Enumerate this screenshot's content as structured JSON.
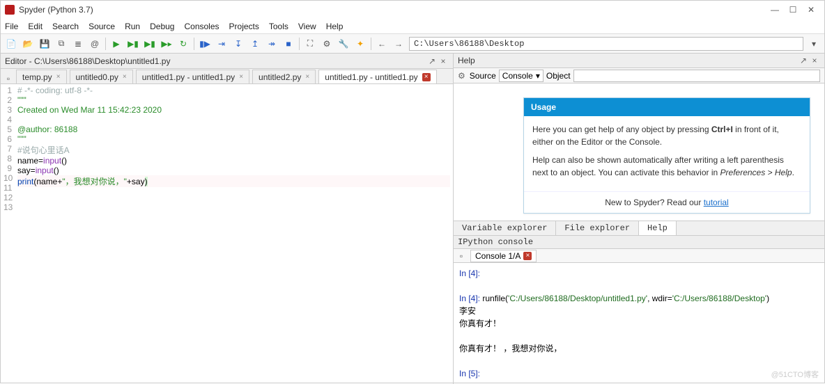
{
  "window": {
    "title": "Spyder (Python 3.7)"
  },
  "menus": [
    "File",
    "Edit",
    "Search",
    "Source",
    "Run",
    "Debug",
    "Consoles",
    "Projects",
    "Tools",
    "View",
    "Help"
  ],
  "path": "C:\\Users\\86188\\Desktop",
  "editor": {
    "pane_title": "Editor - C:\\Users\\86188\\Desktop\\untitled1.py",
    "tabs": [
      {
        "label": "temp.py",
        "dirty": false
      },
      {
        "label": "untitled0.py",
        "dirty": false
      },
      {
        "label": "untitled1.py - untitled1.py",
        "dirty": false
      },
      {
        "label": "untitled2.py",
        "dirty": false
      },
      {
        "label": "untitled1.py - untitled1.py",
        "dirty": true,
        "active": true
      }
    ],
    "lines": [
      {
        "n": 1,
        "html": "<span class='c-gray'># -*- coding: utf-8 -*-</span>"
      },
      {
        "n": 2,
        "html": "<span class='c-green'>\"\"\"</span>"
      },
      {
        "n": 3,
        "html": "<span class='c-green'>Created on Wed Mar 11 15:42:23 2020</span>"
      },
      {
        "n": 4,
        "html": ""
      },
      {
        "n": 5,
        "html": "<span class='c-green'>@author: 86188</span>"
      },
      {
        "n": 6,
        "html": "<span class='c-green'>\"\"\"</span>"
      },
      {
        "n": 7,
        "html": "<span class='c-gray'>#说句心里话A</span>"
      },
      {
        "n": 8,
        "html": "name=<span class='c-purple'>input</span>()"
      },
      {
        "n": 9,
        "html": "say=<span class='c-purple'>input</span>()"
      },
      {
        "n": 10,
        "html": "<span class='line10'><span class='c-blue'>print</span>(name+<span class='c-str'>\"，我想对你说，\"</span>+say<span style='background:#d4f5d4'>)</span></span>"
      },
      {
        "n": 11,
        "html": ""
      },
      {
        "n": 12,
        "html": ""
      },
      {
        "n": 13,
        "html": ""
      }
    ]
  },
  "help": {
    "pane_title": "Help",
    "source_label": "Source",
    "source_value": "Console",
    "object_label": "Object",
    "object_value": "",
    "usage_title": "Usage",
    "p1a": "Here you can get help of any object by pressing ",
    "p1b": "Ctrl+I",
    "p1c": " in front of it, either on the Editor or the Console.",
    "p2a": "Help can also be shown automatically after writing a left parenthesis next to an object. You can activate this behavior in ",
    "p2b": "Preferences > Help",
    "p2c": ".",
    "footer_text": "New to Spyder? Read our ",
    "footer_link": "tutorial"
  },
  "subtabs": [
    "Variable explorer",
    "File explorer",
    "Help"
  ],
  "ipython": {
    "title": "IPython console",
    "tab": "Console 1/A",
    "lines": [
      {
        "t": "prompt",
        "v": "In [4]:"
      },
      {
        "t": "blank"
      },
      {
        "t": "run",
        "pre": "In [4]: ",
        "fn": "runfile(",
        "a": "'C:/Users/86188/Desktop/untitled1.py'",
        "mid": ", wdir=",
        "b": "'C:/Users/86188/Desktop'",
        "post": ")"
      },
      {
        "t": "out",
        "v": "李安"
      },
      {
        "t": "out",
        "v": "你真有才！"
      },
      {
        "t": "blank"
      },
      {
        "t": "out",
        "v": "你真有才！ ，我想对你说，"
      },
      {
        "t": "blank"
      },
      {
        "t": "prompt",
        "v": "In [5]: "
      }
    ]
  },
  "watermark": "@51CTO博客"
}
